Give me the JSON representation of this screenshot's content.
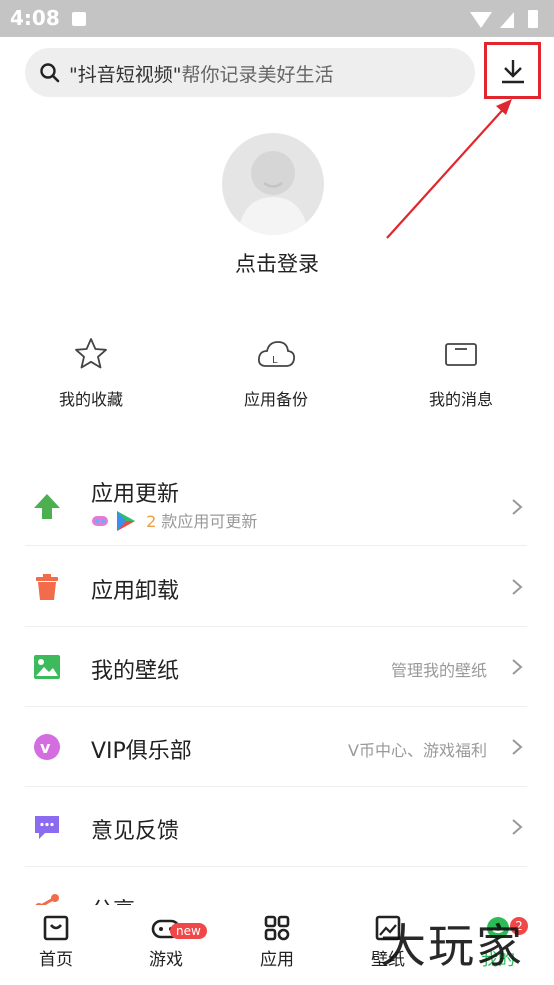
{
  "status_bar": {
    "time": "4:08"
  },
  "search": {
    "highlight": "\"抖音短视频\"",
    "rest": "帮你记录美好生活"
  },
  "profile": {
    "login_label": "点击登录"
  },
  "quick_actions": [
    {
      "label": "我的收藏",
      "icon": "star-icon"
    },
    {
      "label": "应用备份",
      "icon": "cloud-backup-icon"
    },
    {
      "label": "我的消息",
      "icon": "message-icon"
    }
  ],
  "menu": [
    {
      "label": "应用更新",
      "sub_count": "2",
      "sub_text": "款应用可更新",
      "right": "",
      "icon": "update-arrow-icon",
      "color": "#4caf50"
    },
    {
      "label": "应用卸载",
      "right": "",
      "icon": "trash-icon",
      "color": "#f26b4a"
    },
    {
      "label": "我的壁纸",
      "right": "管理我的壁纸",
      "icon": "wallpaper-icon",
      "color": "#3dbb5c"
    },
    {
      "label": "VIP俱乐部",
      "right": "V币中心、游戏福利",
      "icon": "vip-icon",
      "color": "#d36de0"
    },
    {
      "label": "意见反馈",
      "right": "",
      "icon": "feedback-icon",
      "color": "#8b6cf0"
    },
    {
      "label": "分享",
      "right": "",
      "icon": "share-icon",
      "color": "#f26b4a"
    }
  ],
  "bottom_nav": [
    {
      "label": "首页",
      "icon": "home-icon"
    },
    {
      "label": "游戏",
      "icon": "gamepad-icon",
      "badge": "new"
    },
    {
      "label": "应用",
      "icon": "apps-icon"
    },
    {
      "label": "壁纸",
      "icon": "wallpaper-tab-icon"
    },
    {
      "label": "我的",
      "icon": "profile-tab-icon",
      "badge": "2"
    }
  ],
  "watermark": "大玩家",
  "colors": {
    "accent_green": "#2dbb57",
    "annotation_red": "#e2262d",
    "badge_red": "#f04848"
  }
}
